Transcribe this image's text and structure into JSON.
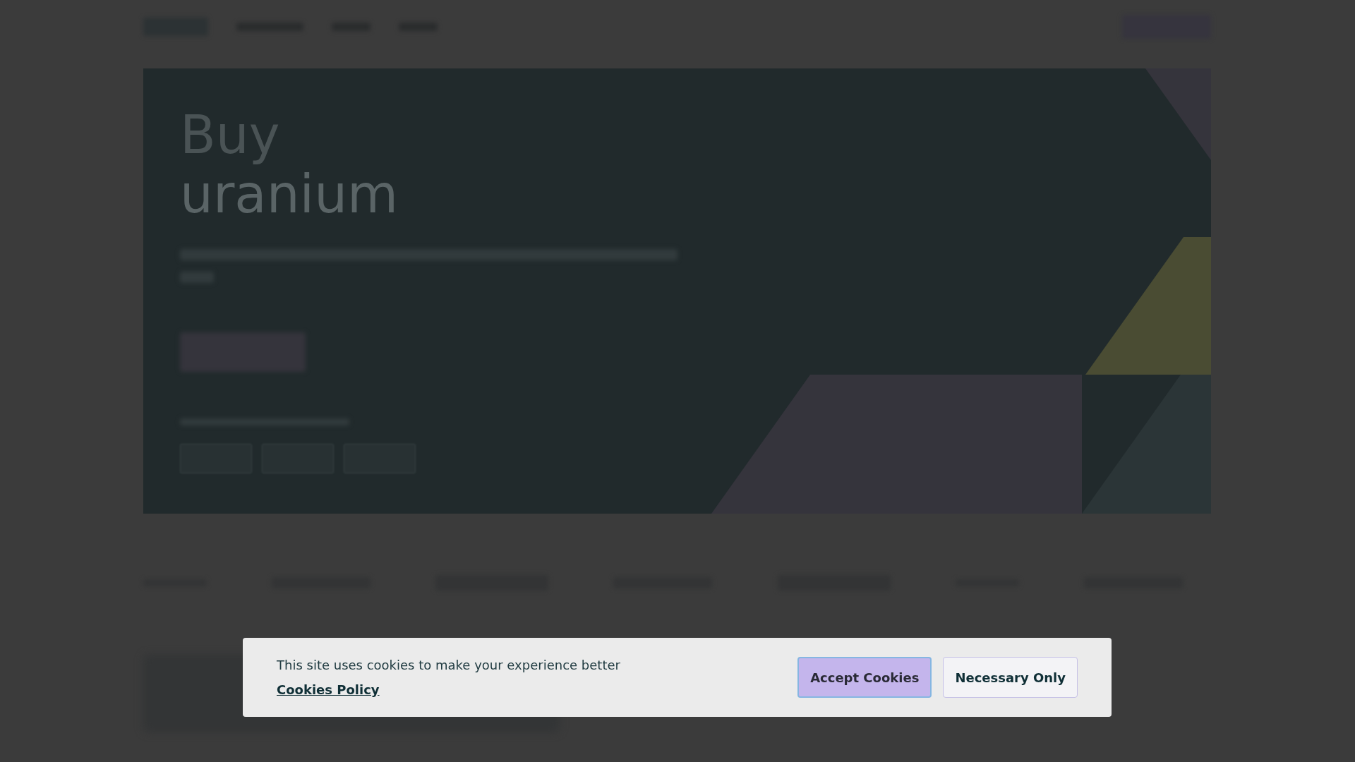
{
  "hero": {
    "title_lines": [
      "Buy",
      "uranium"
    ]
  },
  "cookie_banner": {
    "message": "This site uses cookies to make your experience better",
    "policy_link": "Cookies Policy",
    "buttons": [
      {
        "label": "Accept Cookies",
        "kind": "primary"
      },
      {
        "label": "Necessary Only",
        "kind": "secondary"
      }
    ]
  }
}
